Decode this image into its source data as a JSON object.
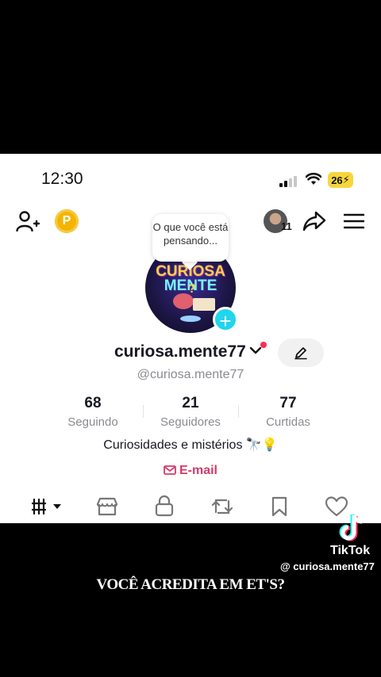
{
  "status_bar": {
    "time": "12:30",
    "battery": "26"
  },
  "header": {
    "friend_count": "11"
  },
  "profile": {
    "thought_bubble": "O que você está pensando...",
    "avatar_text_1": "CURIOSA",
    "avatar_text_2": "MENTE",
    "username": "curiosa.mente77",
    "handle": "@curiosa.mente77",
    "bio": "Curiosidades e mistérios 🔭💡",
    "email_label": "E-mail"
  },
  "stats": [
    {
      "value": "68",
      "label": "Seguindo"
    },
    {
      "value": "21",
      "label": "Seguidores"
    },
    {
      "value": "77",
      "label": "Curtidas"
    }
  ],
  "watermark": {
    "brand": "TikTok",
    "handle": "@ curiosa.mente77"
  },
  "caption": "VOCÊ ACREDITA EM ET'S?",
  "colors": {
    "accent_cyan": "#20d5ec",
    "accent_red": "#fe2c55",
    "email_pink": "#d43b6a",
    "coin": "#f4b400"
  }
}
